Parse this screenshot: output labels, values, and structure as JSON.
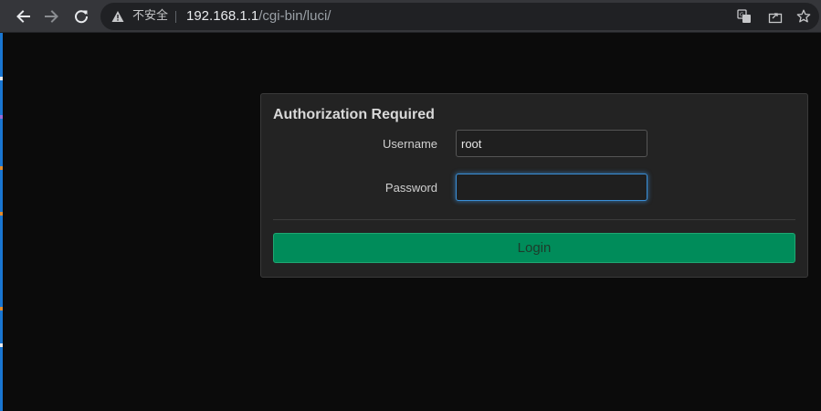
{
  "browser": {
    "security_label": "不安全",
    "url_host": "192.168.1.1",
    "url_path": "/cgi-bin/luci/",
    "icons": {
      "back": "back-arrow-icon",
      "forward": "forward-arrow-icon",
      "reload": "reload-icon",
      "warning": "warning-triangle-icon",
      "translate": "translate-icon",
      "share": "share-icon",
      "bookmark": "bookmark-star-icon"
    }
  },
  "login": {
    "title": "Authorization Required",
    "username_label": "Username",
    "username_value": "root",
    "password_label": "Password",
    "password_value": "",
    "button_label": "Login"
  },
  "colors": {
    "page_background": "#0b0b0b",
    "panel_background": "#232323",
    "button_background": "#008c5a",
    "focus_ring": "#3a8fd8",
    "sidebar_accent": "#1976d2"
  }
}
